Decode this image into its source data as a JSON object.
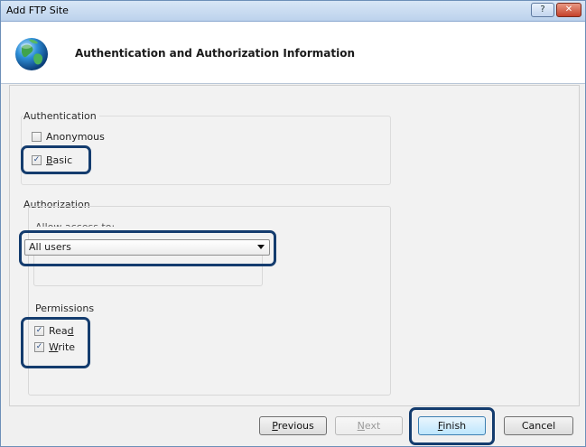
{
  "window": {
    "title": "Add FTP Site",
    "help_glyph": "?",
    "close_glyph": "✕"
  },
  "header": {
    "title": "Authentication and Authorization Information",
    "icon": "globe-icon"
  },
  "authentication": {
    "group_label": "Authentication",
    "anonymous": {
      "label_pre": "",
      "label_key": "",
      "label_post": "Anonymous",
      "checked": false
    },
    "basic": {
      "label_pre": "",
      "label_key": "B",
      "label_post": "asic",
      "checked": true
    }
  },
  "authorization": {
    "group_label": "Authorization",
    "allow_access_label": "Allow access to:",
    "selected_option": "All users"
  },
  "permissions": {
    "group_label": "Permissions",
    "read": {
      "label_pre": "Rea",
      "label_key": "d",
      "label_post": "",
      "checked": true
    },
    "write": {
      "label_pre": "",
      "label_key": "W",
      "label_post": "rite",
      "checked": true
    }
  },
  "buttons": {
    "previous": {
      "key": "P",
      "rest": "revious"
    },
    "next": {
      "key": "N",
      "rest": "ext"
    },
    "finish": {
      "key": "F",
      "rest": "inish"
    },
    "cancel": "Cancel"
  },
  "colors": {
    "highlight": "#143c6e",
    "titlebar": "#c8dbf1",
    "close_button": "#c5412a"
  }
}
